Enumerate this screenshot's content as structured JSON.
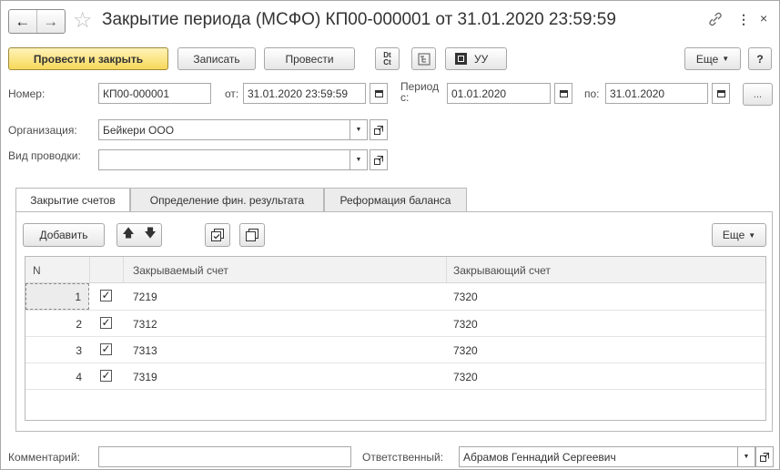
{
  "title": "Закрытие периода (МСФО) КП00-000001 от 31.01.2020 23:59:59",
  "toolbar": {
    "post_and_close": "Провести и закрыть",
    "save": "Записать",
    "post": "Провести",
    "dtct": "Dt Ct",
    "uu": "УУ",
    "more": "Еще",
    "help": "?"
  },
  "form": {
    "number_label": "Номер:",
    "number_value": "КП00-000001",
    "from_label": "от:",
    "date_value": "31.01.2020 23:59:59",
    "period_label": "Период с:",
    "period_from": "01.01.2020",
    "to_label": "по:",
    "period_to": "31.01.2020",
    "ellipsis": "...",
    "org_label": "Организация:",
    "org_value": "Бейкери ООО",
    "entry_type_label": "Вид проводки:",
    "entry_type_value": ""
  },
  "tabs": [
    {
      "label": "Закрытие счетов"
    },
    {
      "label": "Определение фин. результата"
    },
    {
      "label": "Реформация баланса"
    }
  ],
  "table_toolbar": {
    "add": "Добавить",
    "more": "Еще"
  },
  "table": {
    "columns": [
      "N",
      "",
      "Закрываемый счет",
      "Закрывающий счет"
    ],
    "rows": [
      {
        "n": "1",
        "checked": true,
        "closed": "7219",
        "closing": "7320"
      },
      {
        "n": "2",
        "checked": true,
        "closed": "7312",
        "closing": "7320"
      },
      {
        "n": "3",
        "checked": true,
        "closed": "7313",
        "closing": "7320"
      },
      {
        "n": "4",
        "checked": true,
        "closed": "7319",
        "closing": "7320"
      }
    ]
  },
  "footer": {
    "comment_label": "Комментарий:",
    "comment_value": "",
    "responsible_label": "Ответственный:",
    "responsible_value": "Абрамов Геннадий Сергеевич"
  }
}
